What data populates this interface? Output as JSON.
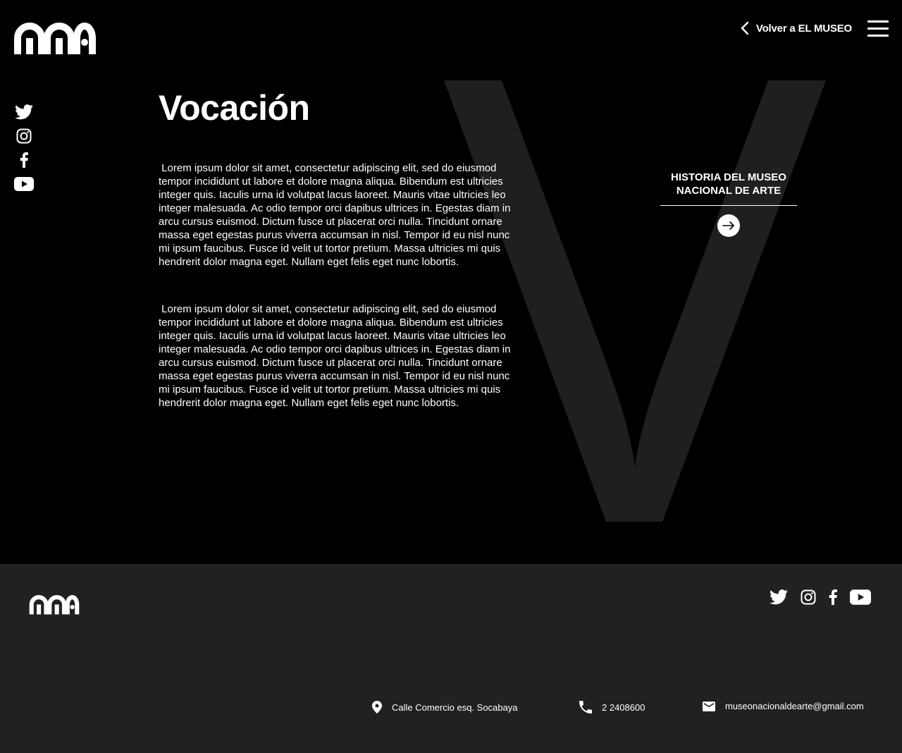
{
  "header": {
    "logo_icon": "mna-logo",
    "back_label": "Volver a EL MUSEO",
    "menu_icon": "hamburger-menu-icon"
  },
  "social": [
    {
      "name": "twitter-icon"
    },
    {
      "name": "instagram-icon"
    },
    {
      "name": "facebook-icon"
    },
    {
      "name": "youtube-icon"
    }
  ],
  "main": {
    "title": "Vocación",
    "decorative_letter": "V",
    "paragraphs": [
      " Lorem ipsum dolor sit amet, consectetur adipiscing elit, sed do eiusmod tempor incididunt ut labore et dolore magna aliqua. Bibendum est ultricies integer quis. Iaculis urna id volutpat lacus laoreet. Mauris vitae ultricies leo integer malesuada. Ac odio tempor orci dapibus ultrices in. Egestas diam in arcu cursus euismod. Dictum fusce ut placerat orci nulla. Tincidunt ornare massa eget egestas purus viverra accumsan in nisl. Tempor id eu nisl nunc mi ipsum faucibus. Fusce id velit ut tortor pretium. Massa ultricies mi quis hendrerit dolor magna eget. Nullam eget felis eget nunc lobortis.",
      " Lorem ipsum dolor sit amet, consectetur adipiscing elit, sed do eiusmod tempor incididunt ut labore et dolore magna aliqua. Bibendum est ultricies integer quis. Iaculis urna id volutpat lacus laoreet. Mauris vitae ultricies leo integer malesuada. Ac odio tempor orci dapibus ultrices in. Egestas diam in arcu cursus euismod. Dictum fusce ut placerat orci nulla. Tincidunt ornare massa eget egestas purus viverra accumsan in nisl. Tempor id eu nisl nunc mi ipsum faucibus. Fusce id velit ut tortor pretium. Massa ultricies mi quis hendrerit dolor magna eget. Nullam eget felis eget nunc lobortis."
    ],
    "card": {
      "title_line1": "HISTORIA DEL MUSEO",
      "title_line2": "NACIONAL DE ARTE",
      "arrow_icon": "arrow-right-icon"
    }
  },
  "footer": {
    "address": "Calle Comercio esq. Socabaya",
    "phone": "2 2408600",
    "email": "museonacionaldearte@gmail.com"
  },
  "colors": {
    "background": "#000000",
    "footer_bg": "#212121",
    "big_letter": "#1f1f1f",
    "text": "#ffffff"
  }
}
